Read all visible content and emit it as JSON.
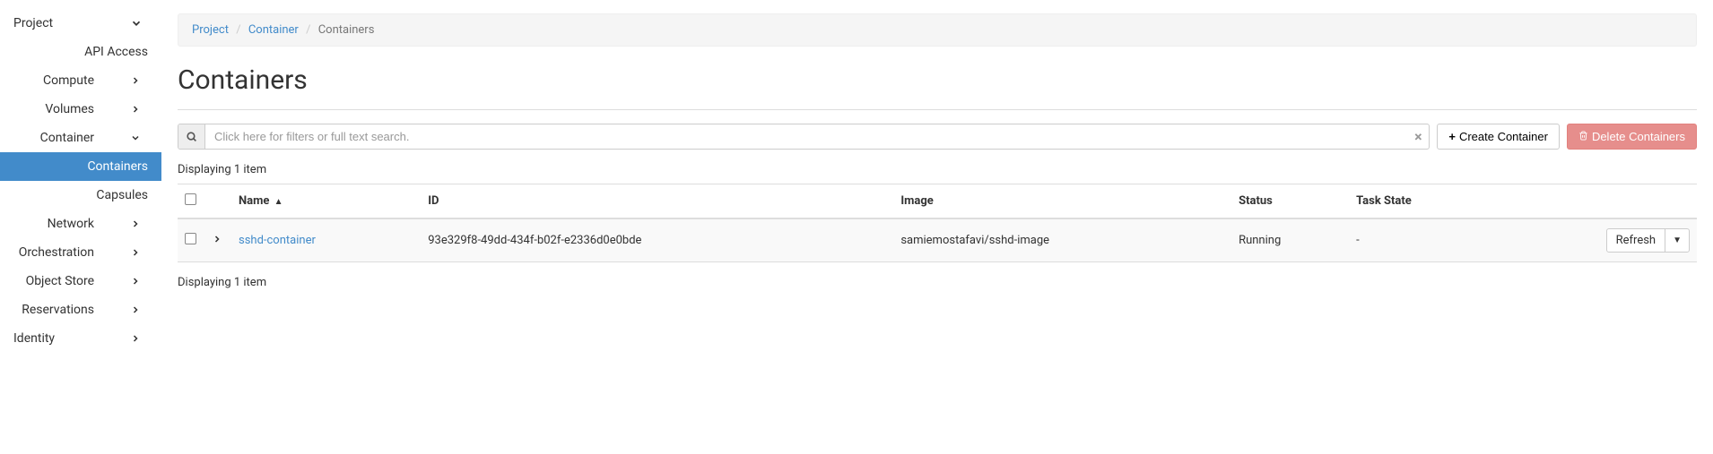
{
  "sidebar": {
    "top": {
      "label": "Project"
    },
    "api_access": "API Access",
    "items": [
      {
        "label": "Compute"
      },
      {
        "label": "Volumes"
      },
      {
        "label": "Container"
      },
      {
        "label": "Network"
      },
      {
        "label": "Orchestration"
      },
      {
        "label": "Object Store"
      },
      {
        "label": "Reservations"
      }
    ],
    "container_sub": [
      {
        "label": "Containers"
      },
      {
        "label": "Capsules"
      }
    ],
    "identity": {
      "label": "Identity"
    }
  },
  "breadcrumb": {
    "project": "Project",
    "container": "Container",
    "current": "Containers"
  },
  "page_title": "Containers",
  "search": {
    "placeholder": "Click here for filters or full text search."
  },
  "buttons": {
    "create": "Create Container",
    "delete": "Delete Containers",
    "refresh": "Refresh"
  },
  "display_text_top": "Displaying 1 item",
  "display_text_bottom": "Displaying 1 item",
  "columns": {
    "name": "Name",
    "id": "ID",
    "image": "Image",
    "status": "Status",
    "task_state": "Task State"
  },
  "rows": [
    {
      "name": "sshd-container",
      "id": "93e329f8-49dd-434f-b02f-e2336d0e0bde",
      "image": "samiemostafavi/sshd-image",
      "status": "Running",
      "task_state": "-"
    }
  ]
}
